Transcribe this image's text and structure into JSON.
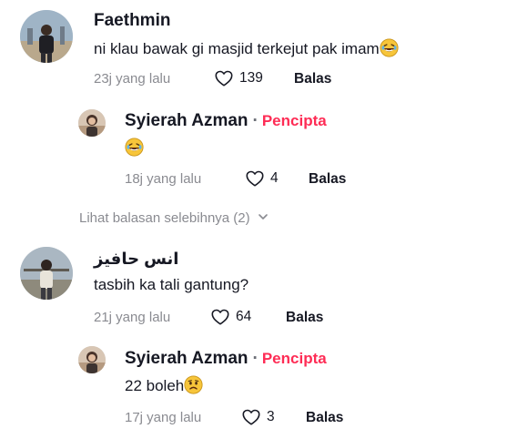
{
  "comments": [
    {
      "username": "Faethmin",
      "text": "ni klau bawak gi masjid terkejut pak imam",
      "emoji": "laughing-emoji",
      "time": "23j yang lalu",
      "likes": "139",
      "reply_label": "Balas",
      "replies": [
        {
          "username": "Syierah Azman",
          "separator": "·",
          "creator_badge": "Pencipta",
          "text": "",
          "emoji": "laughing-emoji",
          "time": "18j yang lalu",
          "likes": "4",
          "reply_label": "Balas"
        }
      ],
      "more_replies": "Lihat balasan selebihnya (2)"
    },
    {
      "username": "انس حافيز",
      "text": "tasbih ka tali gantung?",
      "time": "21j yang lalu",
      "likes": "64",
      "reply_label": "Balas",
      "replies": [
        {
          "username": "Syierah Azman",
          "separator": "·",
          "creator_badge": "Pencipta",
          "text": "22 boleh",
          "emoji": "sad-emoji",
          "time": "17j yang lalu",
          "likes": "3",
          "reply_label": "Balas"
        }
      ]
    }
  ],
  "colors": {
    "creator": "#fe2c55",
    "meta": "#8a8b91",
    "text": "#161823"
  }
}
